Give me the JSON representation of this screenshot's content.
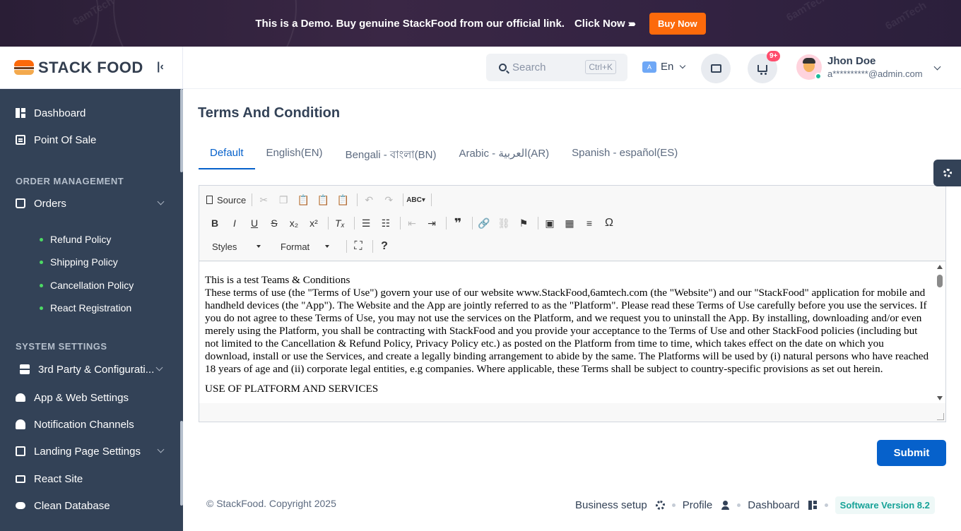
{
  "banner": {
    "text": "This is a Demo. Buy genuine StackFood from our official link.",
    "click_text": "Click Now",
    "arrows": "›››››",
    "button": "Buy Now",
    "watermark": "6amTech"
  },
  "sidebar": {
    "logo_text": "STACK FOOD",
    "items_top": [
      {
        "label": "Dashboard",
        "icon": "dashboard-icon"
      },
      {
        "label": "Point Of Sale",
        "icon": "pos-icon"
      }
    ],
    "section_order": "ORDER MANAGEMENT",
    "orders_label": "Orders",
    "sub_items": [
      "Refund Policy",
      "Shipping Policy",
      "Cancellation Policy",
      "React Registration"
    ],
    "section_system": "SYSTEM SETTINGS",
    "system_items": [
      {
        "label": "3rd Party & Configurati...",
        "icon": "server-icon",
        "has_chevron": true
      },
      {
        "label": "App & Web Settings",
        "icon": "android-icon"
      },
      {
        "label": "Notification Channels",
        "icon": "bell-icon"
      },
      {
        "label": "Landing Page Settings",
        "icon": "landing-icon",
        "has_chevron": true
      },
      {
        "label": "React Site",
        "icon": "react-site-icon"
      },
      {
        "label": "Clean Database",
        "icon": "cloud-icon"
      }
    ]
  },
  "header": {
    "search_placeholder": "Search",
    "search_shortcut": "Ctrl+K",
    "language": "En",
    "cart_badge": "9+",
    "user_name": "Jhon Doe",
    "user_email": "a**********@admin.com"
  },
  "main": {
    "title": "Terms And Condition",
    "tabs": [
      "Default",
      "English(EN)",
      "Bengali - বাংলা(BN)",
      "Arabic - العربية(AR)",
      "Spanish - español(ES)"
    ],
    "active_tab": 0,
    "toolbar": {
      "source_label": "Source",
      "styles_label": "Styles",
      "format_label": "Format"
    },
    "editor_paragraphs": [
      "This is a test Teams & Conditions",
      "These terms of use (the \"Terms of Use\") govern your use of our website www.StackFood,6amtech.com (the \"Website\") and our \"StackFood\" application for mobile and handheld devices (the \"App\"). The Website and the App are jointly referred to as the \"Platform\". Please read these Terms of Use carefully before you use the services. If you do not agree to these Terms of Use, you may not use the services on the Platform, and we request you to uninstall the App. By installing, downloading and/or even merely using the Platform, you shall be contracting with StackFood and you provide your acceptance to the Terms of Use and other StackFood policies (including but not limited to the Cancellation & Refund Policy, Privacy Policy etc.) as posted on the Platform from time to time, which takes effect on the date on which you download, install or use the Services, and create a legally binding arrangement to abide by the same. The Platforms will be used by (i) natural persons who have reached 18 years of age and (ii) corporate legal entities, e.g companies. Where applicable, these Terms shall be subject to country-specific provisions as set out herein.",
      "USE OF PLATFORM AND SERVICES"
    ],
    "submit_label": "Submit"
  },
  "footer": {
    "copyright": "© StackFood. Copyright 2025",
    "links": [
      "Business setup",
      "Profile",
      "Dashboard"
    ],
    "version": "Software Version 8.2"
  },
  "colors": {
    "sidebar_bg": "#334257",
    "primary": "#0661cb",
    "banner_button": "#fc6a0b",
    "badge": "#ff4d6d",
    "version_text": "#16a297"
  }
}
